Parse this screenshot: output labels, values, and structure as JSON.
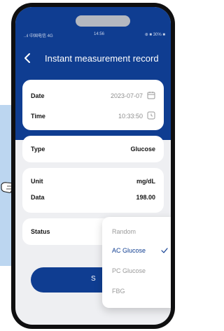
{
  "status_bar": {
    "left": "..ıl 中国电信 4G",
    "time": "14:56",
    "right": "⊕ ■ 30% ■"
  },
  "header": {
    "title": "Instant measurement record"
  },
  "date_time_card": {
    "date_label": "Date",
    "date_value": "2023-07-07",
    "time_label": "Time",
    "time_value": "10:33:50"
  },
  "type_card": {
    "type_label": "Type",
    "type_value": "Glucose"
  },
  "unit_card": {
    "unit_label": "Unit",
    "unit_value": "mg/dL",
    "data_label": "Data",
    "data_value": "198.00"
  },
  "status_card": {
    "status_label": "Status"
  },
  "save_button": {
    "label": "S"
  },
  "dropdown": {
    "options": [
      "Random",
      "AC Glucose",
      "PC Glucose",
      "FBG"
    ],
    "selected": "AC Glucose"
  },
  "colors": {
    "primary": "#0f3d91",
    "background": "#eeeff2",
    "side_panel": "#bcd6f0"
  }
}
